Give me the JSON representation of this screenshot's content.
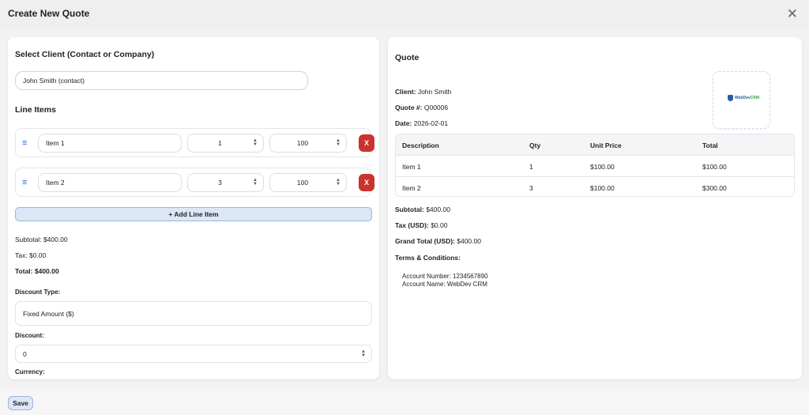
{
  "modal": {
    "title": "Create New Quote",
    "close_icon": "close-icon",
    "close_glyph": "✕"
  },
  "form": {
    "client_heading": "Select Client (Contact or Company)",
    "client_value": "John Smith (contact)",
    "line_items_heading": "Line Items",
    "line_items": [
      {
        "name": "Item 1",
        "qty": "1",
        "price": "100",
        "remove_label": "X"
      },
      {
        "name": "Item 2",
        "qty": "3",
        "price": "100",
        "remove_label": "X"
      }
    ],
    "drag_glyph": "≡",
    "add_line_item_label": "+ Add Line Item",
    "subtotal": "Subtotal: $400.00",
    "tax": "Tax: $0.00",
    "total": "Total: $400.00",
    "discount_type_label": "Discount Type:",
    "discount_type_value": "Fixed Amount ($)",
    "discount_label": "Discount:",
    "discount_value": "0",
    "currency_label": "Currency:"
  },
  "preview": {
    "heading": "Quote",
    "client_label": "Client:",
    "client_value": "John Smith",
    "quote_no_label": "Quote #:",
    "quote_no_value": "Q00006",
    "date_label": "Date:",
    "date_value": "2026-02-01",
    "logo_text_a": "WebDev",
    "logo_text_b": "CRM",
    "table_headers": [
      "Description",
      "Qty",
      "Unit Price",
      "Total"
    ],
    "table_rows": [
      [
        "Item 1",
        "1",
        "$100.00",
        "$100.00"
      ],
      [
        "Item 2",
        "3",
        "$100.00",
        "$300.00"
      ]
    ],
    "subtotal_label": "Subtotal:",
    "subtotal_value": "$400.00",
    "tax_label": "Tax (USD):",
    "tax_value": "$0.00",
    "grand_total_label": "Grand Total (USD):",
    "grand_total_value": "$400.00",
    "terms_heading": "Terms & Conditions:",
    "terms_lines": [
      "Account Number: 1234567890",
      "Account Name: WebDev CRM"
    ]
  },
  "footer": {
    "save_label": "Save"
  },
  "colors": {
    "accent": "#2c6bd6",
    "danger": "#c9342e",
    "button_bg": "#dbe6f7"
  }
}
